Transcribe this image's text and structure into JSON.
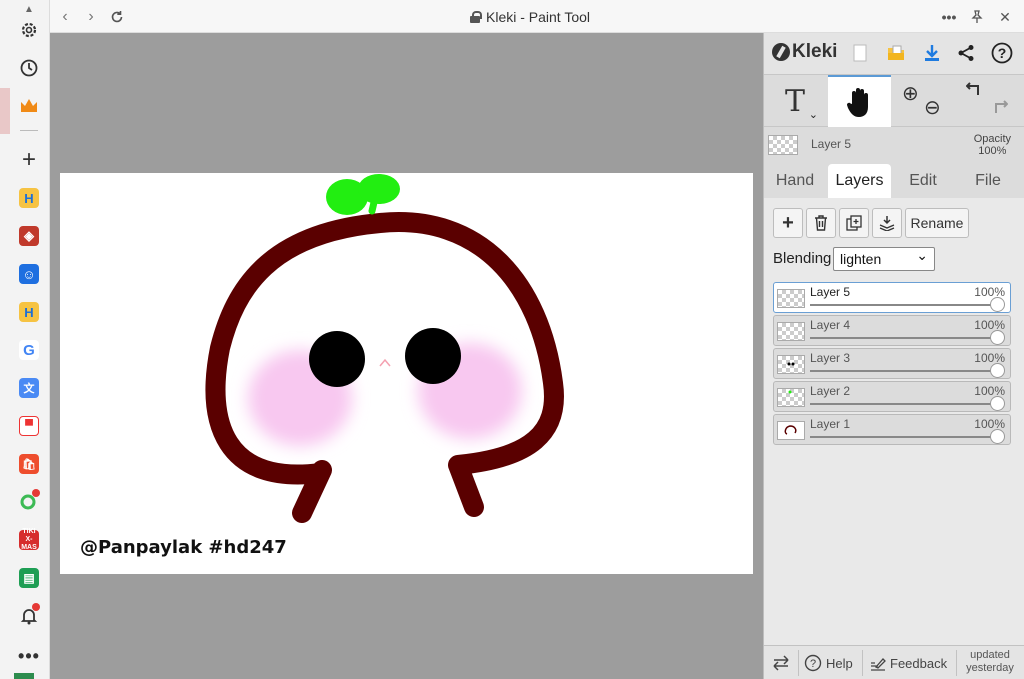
{
  "browser": {
    "title": "Kleki - Paint Tool",
    "more_label": "•••",
    "sidebar_more_label": "•••"
  },
  "canvas": {
    "watermark": "@Panpaylak #hd247"
  },
  "panel": {
    "logo_text": "Kleki",
    "current_layer": "Layer 5",
    "opacity_label": "Opacity",
    "opacity_value": "100%",
    "tabs": [
      {
        "label": "Hand"
      },
      {
        "label": "Layers"
      },
      {
        "label": "Edit"
      },
      {
        "label": "File"
      }
    ],
    "rename_label": "Rename",
    "blending_label": "Blending",
    "blending_value": "lighten",
    "layers": [
      {
        "name": "Layer 5",
        "opacity": "100%"
      },
      {
        "name": "Layer 4",
        "opacity": "100%"
      },
      {
        "name": "Layer 3",
        "opacity": "100%"
      },
      {
        "name": "Layer 2",
        "opacity": "100%"
      },
      {
        "name": "Layer 1",
        "opacity": "100%"
      }
    ],
    "footer": {
      "help_label": "Help",
      "feedback_label": "Feedback",
      "updated_line1": "updated",
      "updated_line2": "yesterday"
    }
  },
  "colors": {
    "accent": "#5b9ad5",
    "outline": "#5a0000",
    "sprout": "#22ee11",
    "blush": "#f8c8f0"
  }
}
